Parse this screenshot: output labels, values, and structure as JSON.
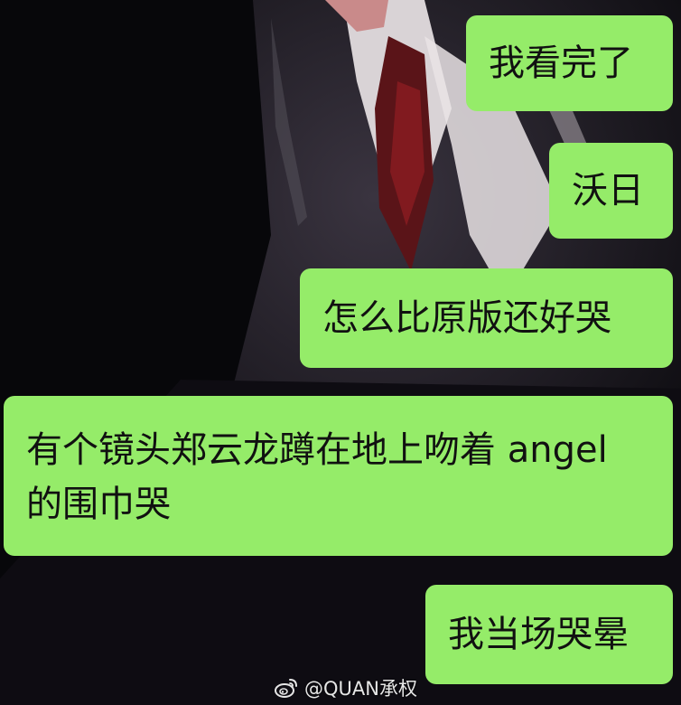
{
  "messages": [
    {
      "id": "msg-1",
      "text": "我看完了"
    },
    {
      "id": "msg-2",
      "text": "沃日"
    },
    {
      "id": "msg-3",
      "text": "怎么比原版还好哭"
    },
    {
      "id": "msg-4",
      "lines": [
        "有个镜头郑云龙蹲在地上吻着 angel",
        "的围巾哭"
      ]
    },
    {
      "id": "msg-5",
      "text": "我当场哭晕"
    }
  ],
  "watermark": {
    "text": "@QUAN承权",
    "icon": "weibo-icon"
  },
  "colors": {
    "bubble": "#95ec69",
    "text": "#111111"
  }
}
